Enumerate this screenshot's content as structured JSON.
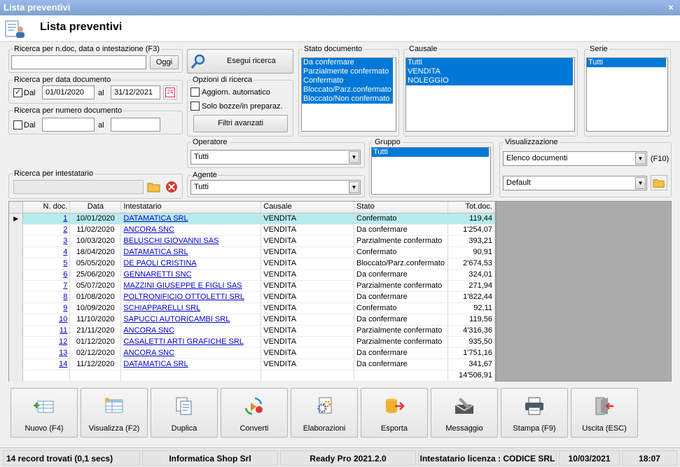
{
  "window": {
    "title": "Lista preventivi",
    "close": "×"
  },
  "header": {
    "title": "Lista preventivi"
  },
  "search_text": {
    "legend": "Ricerca per n.doc, data o intestazione (F3)",
    "value": "",
    "oggi_label": "Oggi"
  },
  "search_button": {
    "label": "Esegui ricerca"
  },
  "date_search": {
    "legend": "Ricerca per data documento",
    "from_label": "Dal",
    "from": "01/01/2020",
    "to_label": "al",
    "to": "31/12/2021",
    "enabled": true,
    "calendar_day": "24"
  },
  "number_search": {
    "legend": "Ricerca per numero documento",
    "from_label": "Dal",
    "to_label": "al",
    "from": "",
    "to": ""
  },
  "options": {
    "legend": "Opzioni di ricerca",
    "auto_update": "Aggiorn. automatico",
    "drafts_only": "Solo bozze/in preparaz.",
    "advanced": "Filtri avanzati"
  },
  "stato": {
    "legend": "Stato documento",
    "items": [
      "Da confermare",
      "Parzialmente confermato",
      "Confermato",
      "Bloccato/Parz.confermato",
      "Bloccato/Non confermato"
    ]
  },
  "causale": {
    "legend": "Causale",
    "items": [
      "Tutti",
      "VENDITA",
      "NOLEGGIO"
    ]
  },
  "serie": {
    "legend": "Serie",
    "items": [
      "Tutti"
    ]
  },
  "operatore": {
    "legend": "Operatore",
    "value": "Tutti"
  },
  "agente": {
    "legend": "Agente",
    "value": "Tutti"
  },
  "gruppo": {
    "legend": "Gruppo",
    "items": [
      "Tutti"
    ]
  },
  "visualizzazione": {
    "legend": "Visualizzazione",
    "value": "Elenco documenti",
    "shortcut": "(F10)",
    "layout": "Default"
  },
  "intestatario": {
    "legend": "Ricerca per intestatario",
    "value": ""
  },
  "table": {
    "headers": [
      "N. doc.",
      "Data",
      "Intestatario",
      "Causale",
      "Stato",
      "Tot.doc."
    ],
    "rows": [
      [
        "1",
        "10/01/2020",
        "DATAMATICA SRL",
        "VENDITA",
        "Confermato",
        "119,44"
      ],
      [
        "2",
        "11/02/2020",
        "ANCORA SNC",
        "VENDITA",
        "Da confermare",
        "1'254,07"
      ],
      [
        "3",
        "10/03/2020",
        "BELUSCHI GIOVANNI SAS",
        "VENDITA",
        "Parzialmente confermato",
        "393,21"
      ],
      [
        "4",
        "18/04/2020",
        "DATAMATICA SRL",
        "VENDITA",
        "Confermato",
        "90,91"
      ],
      [
        "5",
        "05/05/2020",
        "DE PAOLI CRISTINA",
        "VENDITA",
        "Bloccato/Parz.confermato",
        "2'674,53"
      ],
      [
        "6",
        "25/06/2020",
        "GENNARETTI SNC",
        "VENDITA",
        "Da confermare",
        "324,01"
      ],
      [
        "7",
        "05/07/2020",
        "MAZZINI GIUSEPPE E FIGLI SAS",
        "VENDITA",
        "Parzialmente confermato",
        "271,94"
      ],
      [
        "8",
        "01/08/2020",
        "POLTRONIFICIO OTTOLETTI SRL",
        "VENDITA",
        "Da confermare",
        "1'822,44"
      ],
      [
        "9",
        "10/09/2020",
        "SCHIAPPARELLI SRL",
        "VENDITA",
        "Confermato",
        "92,11"
      ],
      [
        "10",
        "11/10/2020",
        "SAPUCCI AUTORICAMBI SRL",
        "VENDITA",
        "Da confermare",
        "119,56"
      ],
      [
        "11",
        "21/11/2020",
        "ANCORA SNC",
        "VENDITA",
        "Parzialmente confermato",
        "4'316,36"
      ],
      [
        "12",
        "01/12/2020",
        "CASALETTI ARTI GRAFICHE SRL",
        "VENDITA",
        "Parzialmente confermato",
        "935,50"
      ],
      [
        "13",
        "02/12/2020",
        "ANCORA SNC",
        "VENDITA",
        "Da confermare",
        "1'751,16"
      ],
      [
        "14",
        "11/12/2020",
        "DATAMATICA SRL",
        "VENDITA",
        "Da confermare",
        "341,67"
      ]
    ],
    "total": "14'506,91"
  },
  "toolbar": [
    {
      "label": "Nuovo (F4)",
      "icon": "new-table-icon"
    },
    {
      "label": "Visualizza (F2)",
      "icon": "view-table-icon"
    },
    {
      "label": "Duplica",
      "icon": "duplicate-icon"
    },
    {
      "label": "Converti",
      "icon": "convert-icon"
    },
    {
      "label": "Elaborazioni",
      "icon": "gears-icon"
    },
    {
      "label": "Esporta",
      "icon": "export-icon"
    },
    {
      "label": "Messaggio",
      "icon": "message-icon"
    },
    {
      "label": "Stampa (F9)",
      "icon": "print-icon"
    },
    {
      "label": "Uscita (ESC)",
      "icon": "exit-icon"
    }
  ],
  "status": {
    "records": "14 record trovati (0,1 secs)",
    "company": "Informatica Shop Srl",
    "app": "Ready Pro 2021.2.0",
    "license": "Intestatario licenza : CODICE SRL",
    "date": "10/03/2021",
    "time": "18:07"
  }
}
